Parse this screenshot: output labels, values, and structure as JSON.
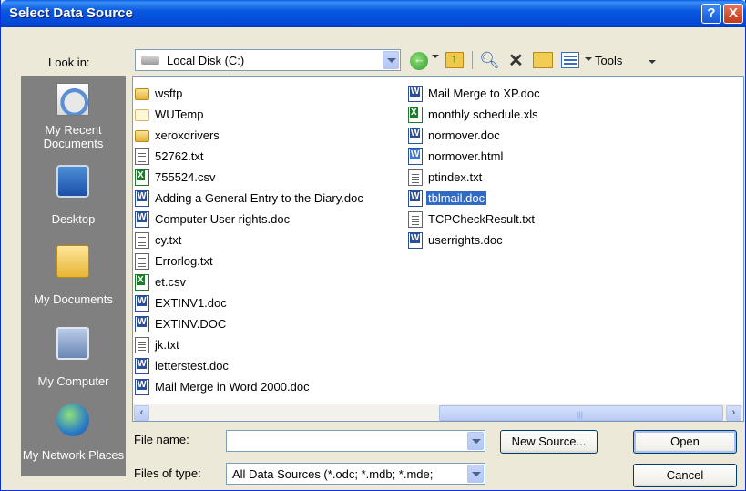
{
  "window": {
    "title": "Select Data Source",
    "help_glyph": "?",
    "close_glyph": "X"
  },
  "toolbar": {
    "look_in_label": "Look in:",
    "look_in_value": "Local Disk (C:)",
    "tools_label": "Tools"
  },
  "places": [
    {
      "name": "recent",
      "label": "My Recent Documents",
      "icon": "recent-documents-icon"
    },
    {
      "name": "desktop",
      "label": "Desktop",
      "icon": "desktop-icon"
    },
    {
      "name": "documents",
      "label": "My Documents",
      "icon": "my-documents-icon"
    },
    {
      "name": "computer",
      "label": "My Computer",
      "icon": "my-computer-icon"
    },
    {
      "name": "network",
      "label": "My Network Places",
      "icon": "network-places-icon"
    }
  ],
  "files": {
    "column1": [
      {
        "name": "wsftp",
        "type": "folder"
      },
      {
        "name": "WUTemp",
        "type": "folder-plain"
      },
      {
        "name": "xeroxdrivers",
        "type": "folder"
      },
      {
        "name": "52762.txt",
        "type": "txt"
      },
      {
        "name": "755524.csv",
        "type": "excel"
      },
      {
        "name": "Adding a General Entry to the Diary.doc",
        "type": "word"
      },
      {
        "name": "Computer User rights.doc",
        "type": "word"
      },
      {
        "name": "cy.txt",
        "type": "txt"
      },
      {
        "name": "Errorlog.txt",
        "type": "txt"
      },
      {
        "name": "et.csv",
        "type": "excel"
      },
      {
        "name": "EXTINV1.doc",
        "type": "word"
      },
      {
        "name": "EXTINV.DOC",
        "type": "word"
      },
      {
        "name": "jk.txt",
        "type": "txt"
      },
      {
        "name": "letterstest.doc",
        "type": "word"
      },
      {
        "name": "Mail Merge in Word 2000.doc",
        "type": "word"
      }
    ],
    "column2": [
      {
        "name": "Mail Merge to XP.doc",
        "type": "word"
      },
      {
        "name": "monthly schedule.xls",
        "type": "excel"
      },
      {
        "name": "normover.doc",
        "type": "word"
      },
      {
        "name": "normover.html",
        "type": "html"
      },
      {
        "name": "ptindex.txt",
        "type": "txt"
      },
      {
        "name": "tblmail.doc",
        "type": "word",
        "selected": true
      },
      {
        "name": "TCPCheckResult.txt",
        "type": "txt"
      },
      {
        "name": "userrights.doc",
        "type": "word"
      }
    ]
  },
  "form": {
    "file_name_label": "File name:",
    "file_name_value": "",
    "file_type_label": "Files of type:",
    "file_type_value": "All Data Sources (*.odc; *.mdb; *.mde;"
  },
  "buttons": {
    "new_source": "New Source...",
    "open": "Open",
    "cancel": "Cancel"
  },
  "colors": {
    "selection": "#316ac5",
    "places_bar": "#808080",
    "title_bar": "#0858e0"
  }
}
